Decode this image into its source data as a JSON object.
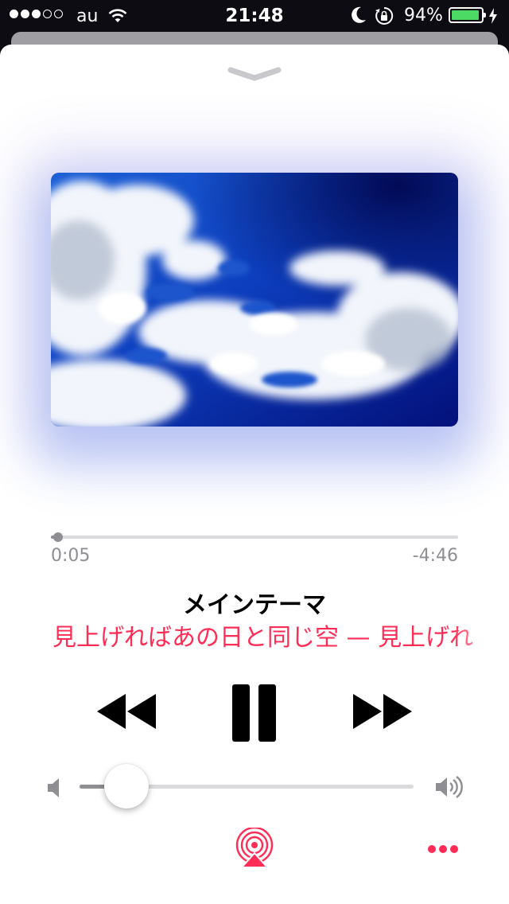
{
  "status_bar": {
    "signal_dots": [
      true,
      true,
      true,
      false,
      false
    ],
    "carrier": "au",
    "time": "21:48",
    "battery_percent": "94%",
    "battery_level": 0.94,
    "battery_color": "#4cd964"
  },
  "player": {
    "elapsed": "0:05",
    "remaining": "-4:46",
    "progress": 0.018,
    "song_title": "メインテーマ",
    "subtitle": "見上げればあの日と同じ空 — 見上げれ",
    "volume": 0.14,
    "accent_color": "#ff2d55"
  },
  "icons": {
    "dismiss": "chevron-down-icon",
    "rewind": "rewind-icon",
    "pause": "pause-icon",
    "forward": "fast-forward-icon",
    "volume_low": "speaker-low-icon",
    "volume_high": "speaker-high-icon",
    "airplay": "airplay-icon",
    "more": "more-icon"
  }
}
